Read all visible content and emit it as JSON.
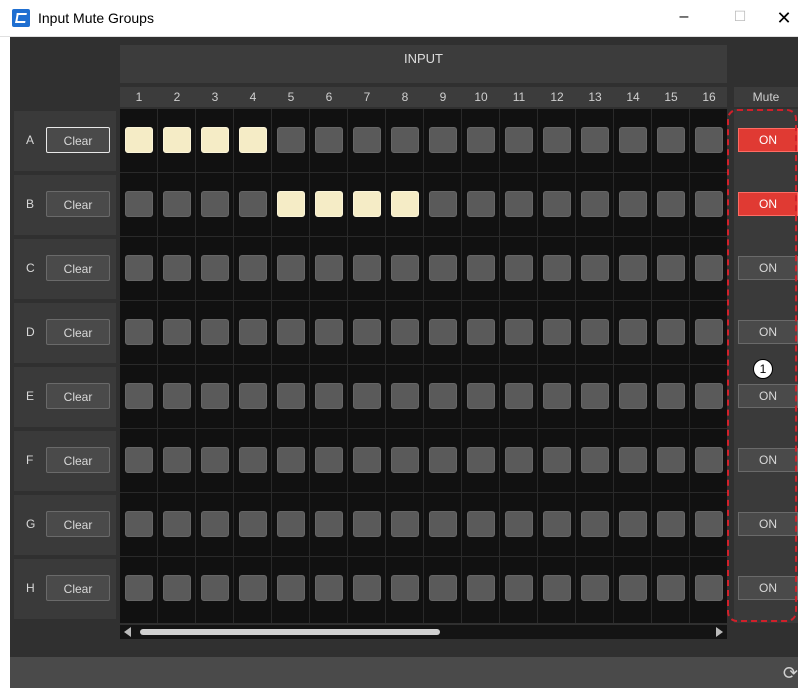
{
  "window": {
    "title": "Input Mute Groups",
    "minimize": "–",
    "maximize": "☐",
    "close": "✕"
  },
  "header": {
    "input_label": "INPUT",
    "mute_label": "Mute",
    "columns": [
      "1",
      "2",
      "3",
      "4",
      "5",
      "6",
      "7",
      "8",
      "9",
      "10",
      "11",
      "12",
      "13",
      "14",
      "15",
      "16"
    ]
  },
  "rows": [
    {
      "letter": "A",
      "clear": "Clear",
      "mute": "ON",
      "mute_active": true,
      "on_inputs": [
        1,
        2,
        3,
        4
      ]
    },
    {
      "letter": "B",
      "clear": "Clear",
      "mute": "ON",
      "mute_active": true,
      "on_inputs": [
        5,
        6,
        7,
        8
      ]
    },
    {
      "letter": "C",
      "clear": "Clear",
      "mute": "ON",
      "mute_active": false,
      "on_inputs": []
    },
    {
      "letter": "D",
      "clear": "Clear",
      "mute": "ON",
      "mute_active": false,
      "on_inputs": []
    },
    {
      "letter": "E",
      "clear": "Clear",
      "mute": "ON",
      "mute_active": false,
      "on_inputs": []
    },
    {
      "letter": "F",
      "clear": "Clear",
      "mute": "ON",
      "mute_active": false,
      "on_inputs": []
    },
    {
      "letter": "G",
      "clear": "Clear",
      "mute": "ON",
      "mute_active": false,
      "on_inputs": []
    },
    {
      "letter": "H",
      "clear": "Clear",
      "mute": "ON",
      "mute_active": false,
      "on_inputs": []
    }
  ],
  "callout": "1",
  "colors": {
    "on_cell": "#f5ecc6",
    "off_cell": "#5a5a5a",
    "mute_active": "#e03a33",
    "annotation": "#d0202a"
  },
  "icons": {
    "app": "app-logo-icon",
    "refresh": "refresh-icon"
  }
}
